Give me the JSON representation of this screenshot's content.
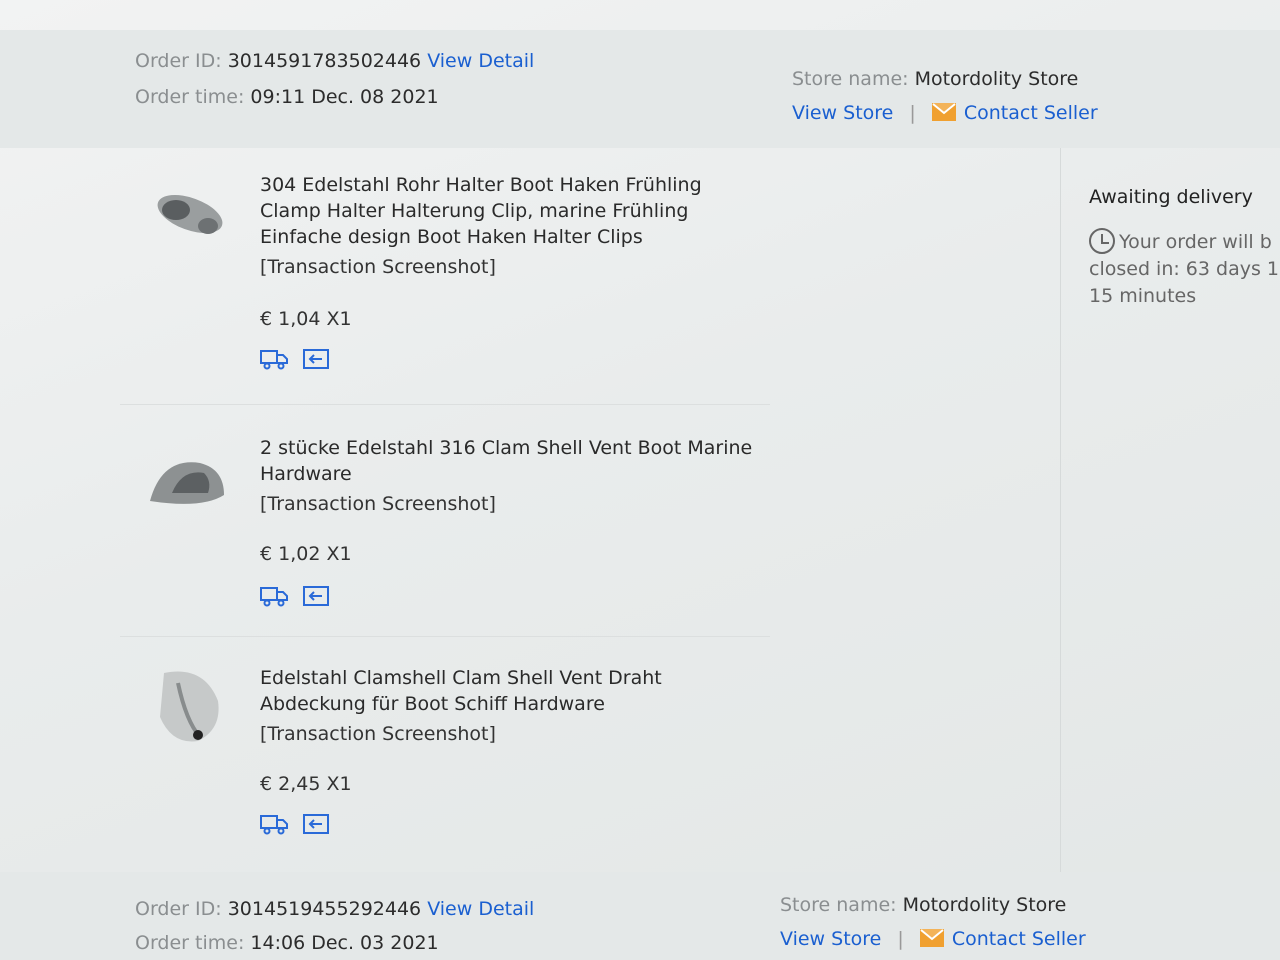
{
  "orders": [
    {
      "order_id_label": "Order ID:",
      "order_id": "3014591783502446",
      "view_detail": "View Detail",
      "order_time_label": "Order time:",
      "order_time": "09:11 Dec. 08 2021",
      "store_name_label": "Store name:",
      "store_name": "Motordolity Store",
      "view_store": "View Store",
      "separator": "|",
      "contact_seller": "Contact Seller"
    },
    {
      "order_id_label": "Order ID:",
      "order_id": "3014519455292446",
      "view_detail": "View Detail",
      "order_time_label": "Order time:",
      "order_time": "14:06 Dec. 03 2021",
      "store_name_label": "Store name:",
      "store_name": "Motordolity Store",
      "view_store": "View Store",
      "separator": "|",
      "contact_seller": "Contact Seller"
    }
  ],
  "items": [
    {
      "title": "304 Edelstahl Rohr Halter Boot Haken Frühling Clamp Halter Halterung Clip, marine Frühling Einfache design Boot Haken Halter Clips",
      "snapshot": "[Transaction Screenshot]",
      "price": "€ 1,04 X1",
      "icons": [
        "truck-icon",
        "return-icon"
      ]
    },
    {
      "title": "2 stücke Edelstahl 316 Clam Shell Vent Boot Marine Hardware",
      "snapshot": "[Transaction Screenshot]",
      "price": "€ 1,02 X1",
      "icons": [
        "truck-icon",
        "return-icon"
      ]
    },
    {
      "title": "Edelstahl Clamshell Clam Shell Vent Draht Abdeckung für Boot Schiff Hardware",
      "snapshot": "[Transaction Screenshot]",
      "price": "€ 2,45 X1",
      "icons": [
        "truck-icon",
        "return-icon"
      ]
    }
  ],
  "status": {
    "title": "Awaiting delivery",
    "line1": "Your order will b",
    "line2": "closed in: 63 days 1",
    "line3": "15 minutes",
    "icon": "clock-icon"
  },
  "colors": {
    "link": "#1a5fd0",
    "mail": "#f0a030",
    "header_bg": "#e4e8e8"
  }
}
